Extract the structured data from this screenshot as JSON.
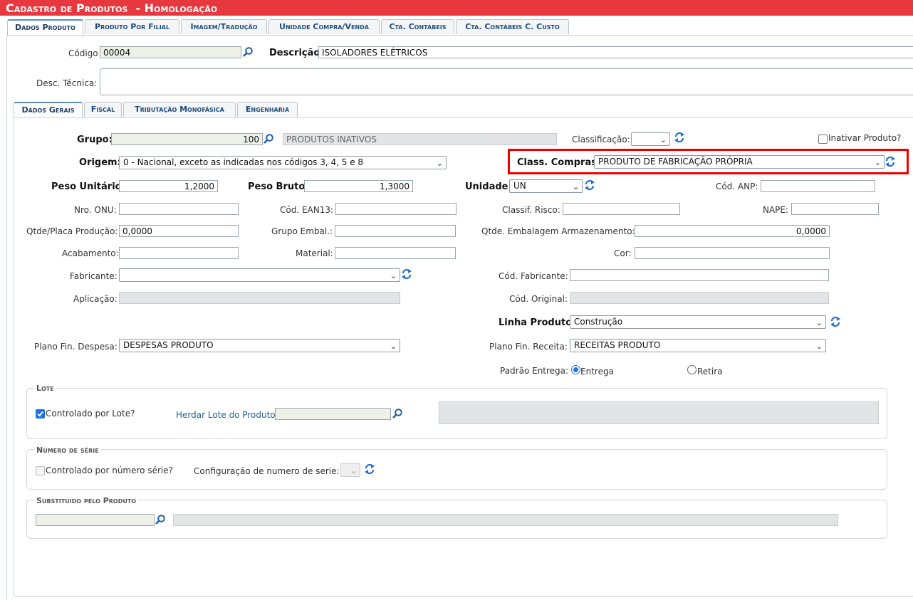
{
  "window": {
    "title": "Cadastro de Produtos  - Homologação"
  },
  "top_tabs": [
    {
      "label": "Dados Produto",
      "active": true
    },
    {
      "label": "Produto Por Filial"
    },
    {
      "label": "Imagem/Tradução"
    },
    {
      "label": "Unidade Compra/Venda"
    },
    {
      "label": "Cta. Contábeis"
    },
    {
      "label": "Cta. Contábeis C. Custo"
    }
  ],
  "header": {
    "codigo_label": "Código",
    "codigo_value": "00004",
    "descricao_label": "Descrição:",
    "descricao_value": "ISOLADORES ELÉTRICOS",
    "desc_tecnica_label": "Desc. Técnica:",
    "desc_tecnica_value": ""
  },
  "sub_tabs": [
    {
      "label": "Dados Gerais",
      "active": true
    },
    {
      "label": "Fiscal"
    },
    {
      "label": "Tributação Monofásica"
    },
    {
      "label": "Engenharia"
    }
  ],
  "form": {
    "grupo_label": "Grupo:",
    "grupo_value": "100",
    "grupo_desc": "PRODUTOS INATIVOS",
    "classificacao_label": "Classificação:",
    "classificacao_value": "",
    "inativar_label": "Inativar Produto?",
    "origem_label": "Origem:",
    "origem_value": "0 - Nacional, exceto as indicadas nos códigos 3, 4, 5 e 8",
    "class_compras_label": "Class. Compras:",
    "class_compras_value": "PRODUTO DE FABRICAÇÃO PRÓPRIA",
    "peso_unitario_label": "Peso Unitário:",
    "peso_unitario_value": "1,2000",
    "peso_bruto_label": "Peso Bruto:",
    "peso_bruto_value": "1,3000",
    "unidade_label": "Unidade:",
    "unidade_value": "UN",
    "cod_anp_label": "Cód. ANP:",
    "cod_anp_value": "",
    "nro_onu_label": "Nro. ONU:",
    "cod_ean13_label": "Cód. EAN13:",
    "classif_risco_label": "Classif. Risco:",
    "nape_label": "NAPE:",
    "qtde_placa_label": "Qtde/Placa Produção:",
    "qtde_placa_value": "0,0000",
    "grupo_embal_label": "Grupo Embal.:",
    "qtde_embalagem_label": "Qtde. Embalagem Armazenamento:",
    "qtde_embalagem_value": "0,0000",
    "acabamento_label": "Acabamento:",
    "material_label": "Material:",
    "cor_label": "Cor:",
    "fabricante_label": "Fabricante:",
    "fabricante_value": "",
    "cod_fabricante_label": "Cód. Fabricante:",
    "aplicacao_label": "Aplicação:",
    "cod_original_label": "Cód. Original:",
    "linha_produto_label": "Linha Produto:",
    "linha_produto_value": "Construção",
    "plano_despesa_label": "Plano Fin. Despesa:",
    "plano_despesa_value": "DESPESAS PRODUTO",
    "plano_receita_label": "Plano Fin. Receita:",
    "plano_receita_value": "RECEITAS PRODUTO",
    "padrao_entrega_label": "Padrão Entrega:",
    "entrega_option": "Entrega",
    "retira_option": "Retira"
  },
  "lote": {
    "legend": "Lote",
    "controlado_label": "Controlado por Lote?",
    "herdar_link": "Herdar Lote do Produto"
  },
  "serie": {
    "legend": "Numero de série",
    "controlado_label": "Controlado por número série?",
    "config_label": "Configuração de numero de serie:"
  },
  "substituido": {
    "legend": "Substituído pelo Produto"
  },
  "colors": {
    "title_bg": "#e8383f",
    "highlight": "#ee0000",
    "accent": "#1a73e8"
  }
}
